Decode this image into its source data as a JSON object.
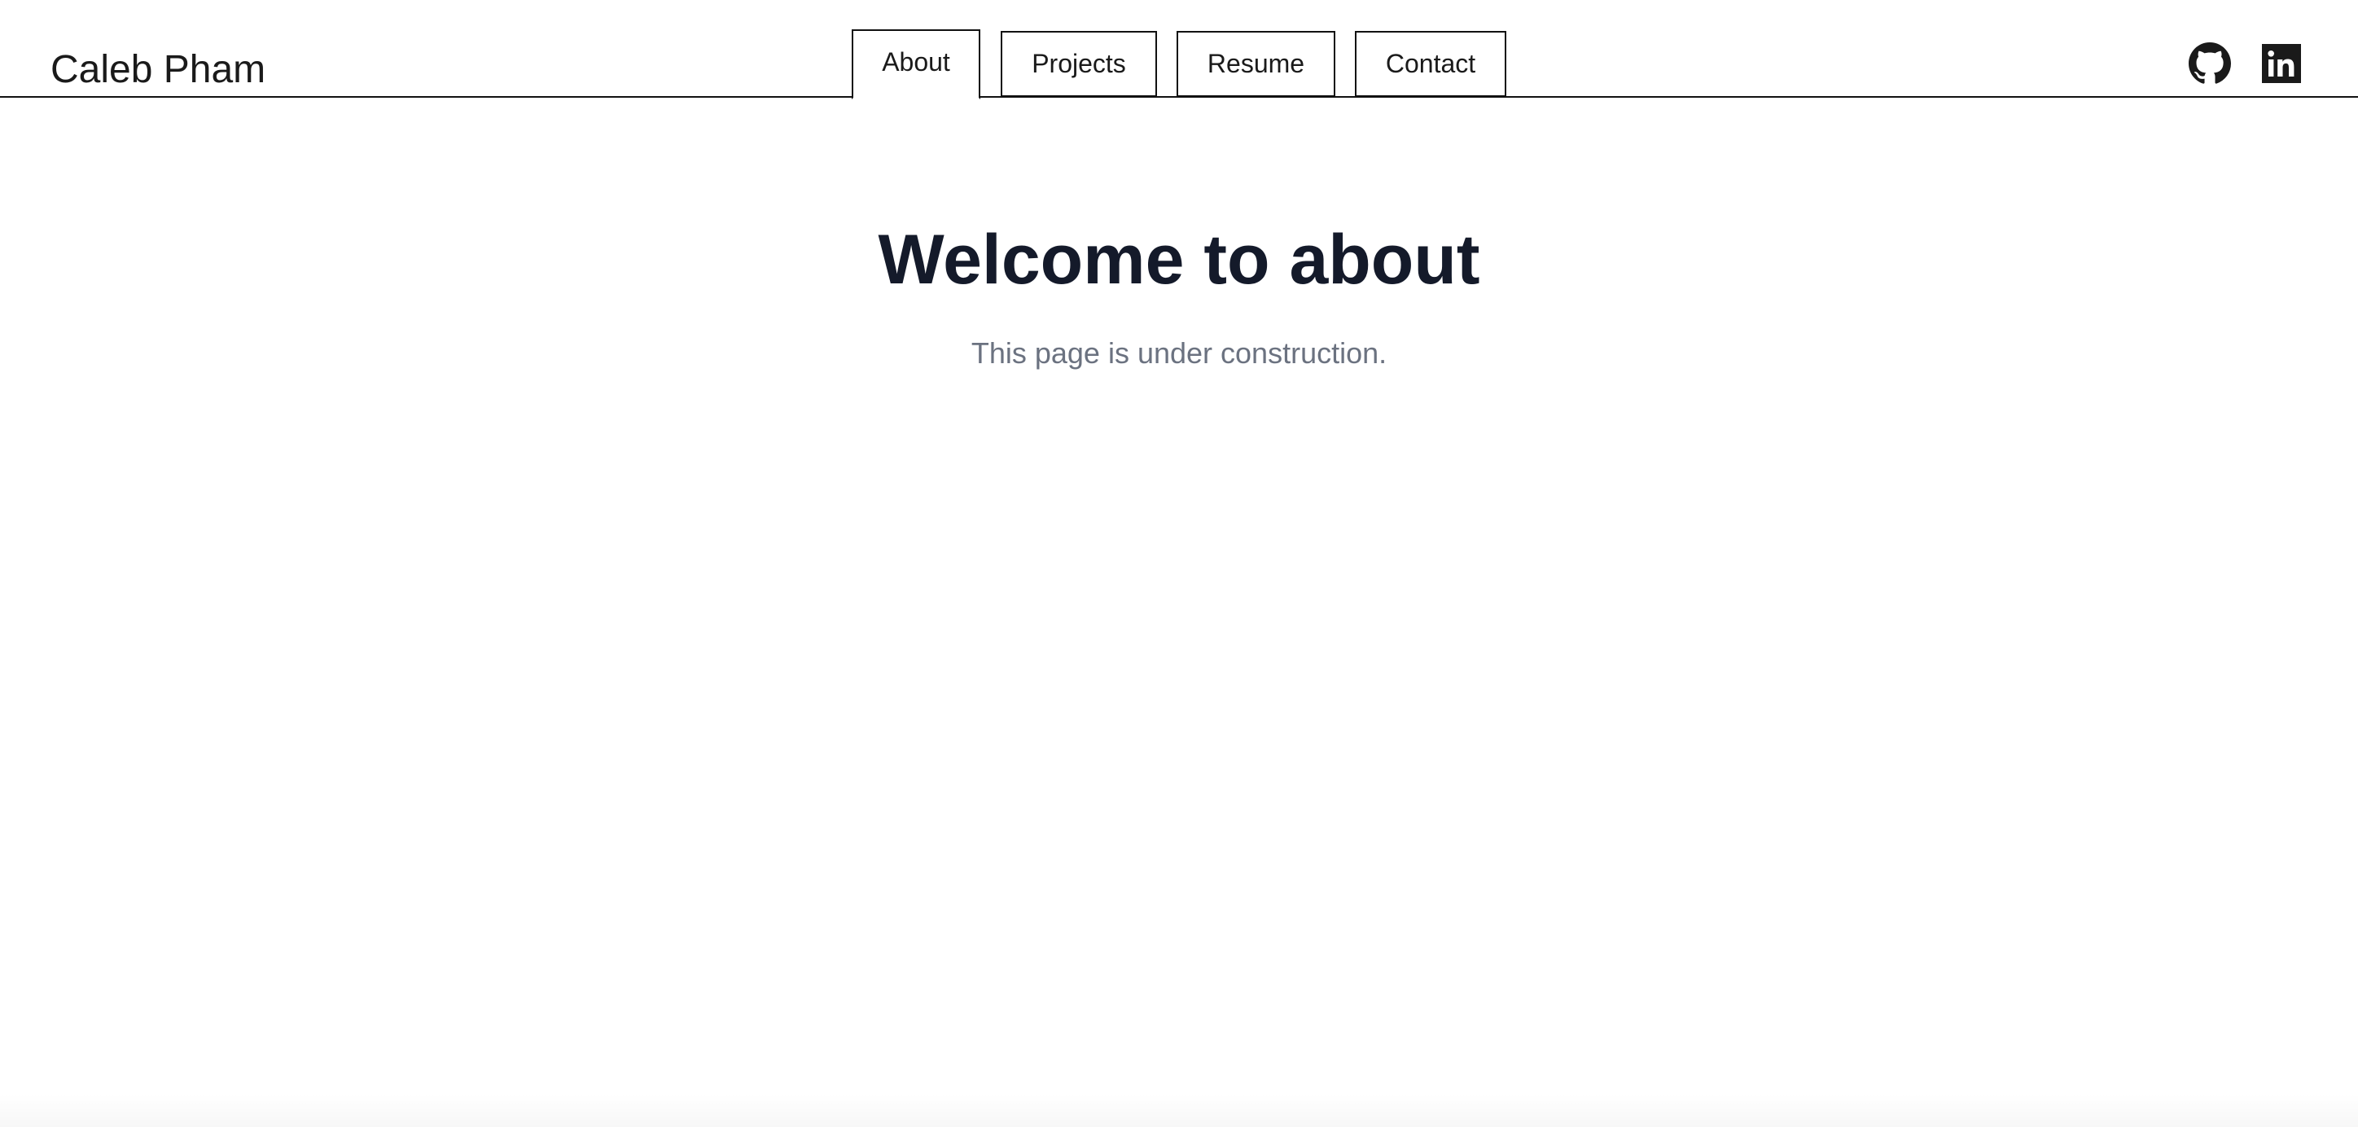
{
  "header": {
    "site_name": "Caleb Pham",
    "tabs": [
      {
        "label": "About",
        "active": true
      },
      {
        "label": "Projects",
        "active": false
      },
      {
        "label": "Resume",
        "active": false
      },
      {
        "label": "Contact",
        "active": false
      }
    ],
    "social_icons": [
      "github-icon",
      "linkedin-icon"
    ]
  },
  "main": {
    "title": "Welcome to about",
    "subtitle": "This page is under construction."
  },
  "colors": {
    "text_dark": "#141a2a",
    "text_muted": "#6b7280",
    "border": "#111111",
    "background": "#ffffff"
  }
}
